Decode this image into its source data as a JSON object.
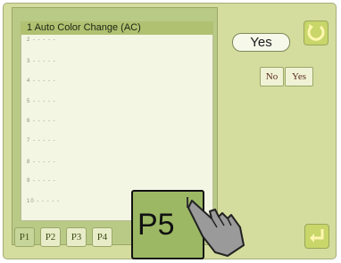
{
  "list": {
    "header": "1 Auto Color Change (AC)",
    "rows": [
      "2 - - - - -",
      "3 - - - - -",
      "4 - - - - -",
      "5 - - - - -",
      "6 - - - - -",
      "7 - - - - -",
      "8 - - - - -",
      "9 - - - - -",
      "10 - - - - -"
    ]
  },
  "tabs": [
    "P1",
    "P2",
    "P3",
    "P4"
  ],
  "buttons": {
    "yes_main": "Yes",
    "no": "No",
    "yes": "Yes"
  },
  "key": {
    "label": "P5"
  },
  "icons": {
    "top_right": "cycle-icon",
    "bottom_right": "enter-icon",
    "pointer": "hand-pointer-icon"
  },
  "colors": {
    "panel": "#b9c986",
    "header": "#b0c172",
    "key": "#9cb864"
  }
}
